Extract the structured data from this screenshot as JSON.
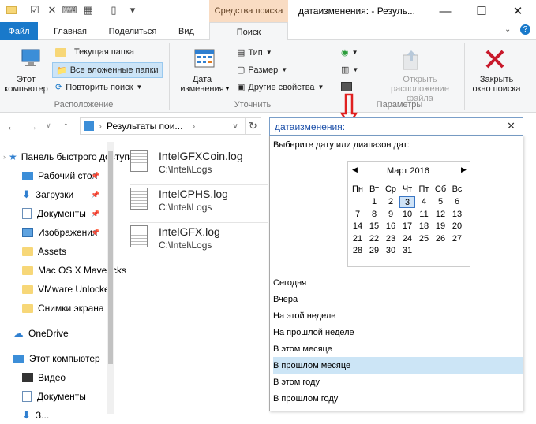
{
  "title": {
    "context_tab": "Средства поиска",
    "window_title": "датаизменения: - Резуль..."
  },
  "tabs": [
    "Файл",
    "Главная",
    "Поделиться",
    "Вид",
    "Поиск"
  ],
  "ribbon": {
    "this_pc": "Этот\nкомпьютер",
    "current_folder": "Текущая папка",
    "all_subfolders": "Все вложенные папки",
    "repeat_search": "Повторить поиск",
    "group_location": "Расположение",
    "date_modified": "Дата\nизменения",
    "type": "Тип",
    "size": "Размер",
    "other_props": "Другие свойства",
    "group_refine": "Уточнить",
    "open_location": "Открыть\nрасположение файла",
    "group_options": "Параметры",
    "close_search": "Закрыть\nокно поиска"
  },
  "address": {
    "path": "Результаты пои..."
  },
  "search": {
    "query": "датаизменения:"
  },
  "nav": {
    "items": [
      {
        "label": "Панель быстрого доступа",
        "icon": "star-icon"
      },
      {
        "label": "Рабочий стол",
        "icon": "desktop-icon",
        "pinned": true
      },
      {
        "label": "Загрузки",
        "icon": "download-icon",
        "pinned": true
      },
      {
        "label": "Документы",
        "icon": "documents-icon",
        "pinned": true
      },
      {
        "label": "Изображения",
        "icon": "pictures-icon",
        "pinned": true
      },
      {
        "label": "Assets",
        "icon": "folder-icon"
      },
      {
        "label": "Mac OS X Mavericks",
        "icon": "folder-icon"
      },
      {
        "label": "VMware Unlocker",
        "icon": "folder-icon"
      },
      {
        "label": "Снимки экрана",
        "icon": "folder-icon"
      },
      {
        "label": "OneDrive",
        "icon": "cloud-icon"
      },
      {
        "label": "Этот компьютер",
        "icon": "computer-icon"
      },
      {
        "label": "Видео",
        "icon": "video-icon"
      },
      {
        "label": "Документы",
        "icon": "documents-icon"
      },
      {
        "label": "З...",
        "icon": "folder-icon"
      }
    ]
  },
  "files": [
    {
      "name": "IntelGFXCoin.log",
      "path": "C:\\Intel\\Logs"
    },
    {
      "name": "IntelCPHS.log",
      "path": "C:\\Intel\\Logs"
    },
    {
      "name": "IntelGFX.log",
      "path": "C:\\Intel\\Logs"
    }
  ],
  "popup": {
    "heading": "Выберите дату или диапазон дат:",
    "month": "Март 2016",
    "weekdays": [
      "Пн",
      "Вт",
      "Ср",
      "Чт",
      "Пт",
      "Сб",
      "Вс"
    ],
    "days": [
      "",
      "",
      "",
      "3",
      "4",
      "5",
      "6",
      "7",
      "8",
      "9",
      "10",
      "11",
      "12",
      "13",
      "14",
      "15",
      "16",
      "17",
      "18",
      "19",
      "20",
      "21",
      "22",
      "23",
      "24",
      "25",
      "26",
      "27",
      "28",
      "29",
      "30",
      "31",
      "",
      "",
      ""
    ],
    "days_fixed": [
      "1",
      "2",
      "3",
      "4",
      "5",
      "6",
      "7",
      "8",
      "9",
      "10",
      "11",
      "12",
      "13",
      "14",
      "15",
      "16",
      "17",
      "18",
      "19",
      "20",
      "21",
      "22",
      "23",
      "24",
      "25",
      "26",
      "27",
      "28",
      "29",
      "30",
      "31"
    ],
    "today": "3",
    "options": [
      "Сегодня",
      "Вчера",
      "На этой неделе",
      "На прошлой неделе",
      "В этом месяце",
      "В прошлом месяце",
      "В этом году",
      "В прошлом году"
    ],
    "selected_option": "В прошлом месяце"
  },
  "colors": {
    "accent": "#1979ca",
    "context_tab": "#f9dcc3",
    "arrow": "#e02020",
    "selection": "#cce5f6"
  }
}
